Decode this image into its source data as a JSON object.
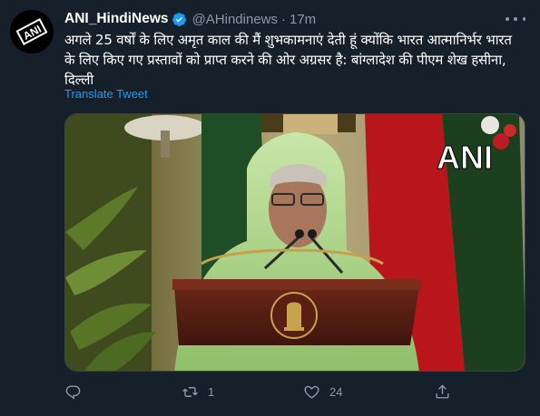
{
  "tweet": {
    "author": {
      "display_name": "ANI_HindiNews",
      "handle": "@AHindinews",
      "verified": true,
      "avatar_text": "ANI"
    },
    "separator": "·",
    "time": "17m",
    "text": "अगले 25 वर्षों के लिए अमृत काल की मैं शुभकामनाएं देती हूं क्योंकि भारत आत्मानिर्भर भारत के लिए किए गए प्रस्तावों को प्राप्त करने की ओर अग्रसर है: बांग्लादेश की पीएम शेख हसीना, दिल्ली",
    "translate_label": "Translate Tweet",
    "media": {
      "watermark": "ANI"
    },
    "actions": {
      "reply": {
        "icon": "reply-icon",
        "count": ""
      },
      "retweet": {
        "icon": "retweet-icon",
        "count": "1"
      },
      "like": {
        "icon": "heart-icon",
        "count": "24"
      },
      "share": {
        "icon": "share-icon",
        "count": ""
      }
    }
  },
  "colors": {
    "background": "#15202b",
    "text_primary": "#ffffff",
    "text_secondary": "#8b98a5",
    "link": "#1d9bf0",
    "verified": "#1d9bf0",
    "border": "#38444d"
  }
}
